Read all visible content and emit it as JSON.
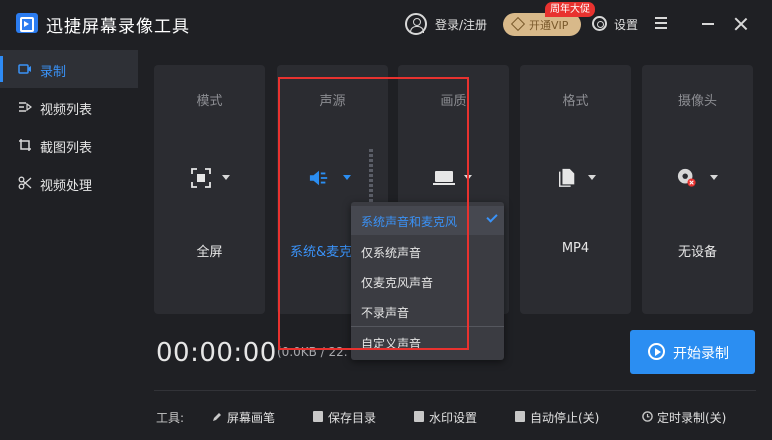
{
  "app": {
    "title": "迅捷屏幕录像工具"
  },
  "header": {
    "login_label": "登录/注册",
    "vip_label": "开通VIP",
    "promo_badge": "周年大促",
    "settings_label": "设置"
  },
  "sidebar": {
    "items": [
      {
        "label": "录制",
        "icon": "record-icon",
        "active": true
      },
      {
        "label": "视频列表",
        "icon": "video-list-icon"
      },
      {
        "label": "截图列表",
        "icon": "screenshot-list-icon"
      },
      {
        "label": "视频处理",
        "icon": "video-process-icon"
      }
    ]
  },
  "cards": [
    {
      "title": "模式",
      "value": "全屏",
      "icon": "fullscreen-icon"
    },
    {
      "title": "声源",
      "value": "系统&麦克",
      "icon": "speaker-icon"
    },
    {
      "title": "画质",
      "value": "",
      "icon": "monitor-icon"
    },
    {
      "title": "格式",
      "value": "MP4",
      "icon": "file-icon"
    },
    {
      "title": "摄像头",
      "value": "无设备",
      "icon": "camera-icon"
    }
  ],
  "recording": {
    "timer": "00:00:00",
    "file_size": "(0.0KB / 22."
  },
  "start_button": {
    "label": "开始录制"
  },
  "toolbar": {
    "prefix": "工具:",
    "items": [
      {
        "label": "屏幕画笔",
        "icon": "pen-icon"
      },
      {
        "label": "保存目录",
        "icon": "folder-icon"
      },
      {
        "label": "水印设置",
        "icon": "watermark-icon"
      },
      {
        "label": "自动停止(关)",
        "icon": "auto-stop-icon"
      },
      {
        "label": "定时录制(关)",
        "icon": "timer-icon"
      }
    ]
  },
  "audio_dropdown": {
    "options": [
      {
        "label": "系统声音和麦克风",
        "selected": true
      },
      {
        "label": "仅系统声音"
      },
      {
        "label": "仅麦克风声音"
      },
      {
        "label": "不录声音"
      },
      {
        "label": "自定义声音"
      }
    ]
  },
  "colors": {
    "accent": "#2b8ef2",
    "highlight_box": "#e8322f",
    "background": "#1f2024",
    "card": "#2b2c31"
  }
}
